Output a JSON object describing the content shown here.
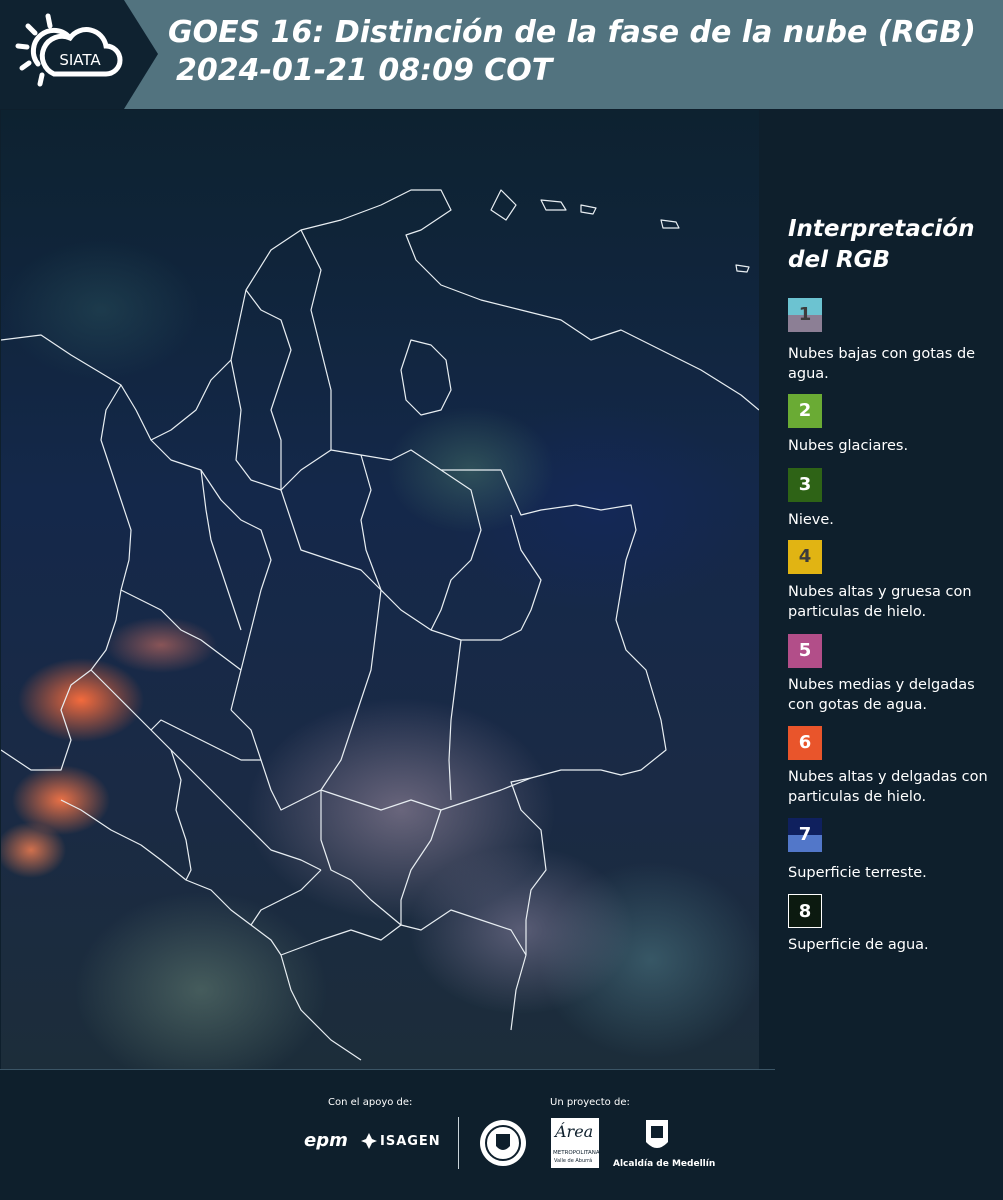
{
  "header": {
    "logo_text": "SIATA",
    "title": "GOES 16: Distinción de la fase de la nube (RGB)",
    "subtitle": "2024-01-21 08:09 COT"
  },
  "legend": {
    "title": "Interpretación del RGB",
    "items": [
      {
        "number": "1",
        "label": "Nubes bajas con gotas de agua.",
        "color_top": "#6cc3d1",
        "color_bottom": "#8c7f95"
      },
      {
        "number": "2",
        "label": "Nubes glaciares.",
        "color_top": "#6aab34",
        "color_bottom": "#6aab34"
      },
      {
        "number": "3",
        "label": "Nieve.",
        "color_top": "#2e6316",
        "color_bottom": "#2e6316"
      },
      {
        "number": "4",
        "label": "Nubes altas y gruesa con particulas de hielo.",
        "color_top": "#e1b413",
        "color_bottom": "#e1b413"
      },
      {
        "number": "5",
        "label": "Nubes medias y delgadas con gotas de agua.",
        "color_top": "#b24e89",
        "color_bottom": "#b24e89"
      },
      {
        "number": "6",
        "label": "Nubes altas y delgadas con particulas de hielo.",
        "color_top": "#e9552b",
        "color_bottom": "#e9552b"
      },
      {
        "number": "7",
        "label": "Superficie terreste.",
        "color_top": "#0f205e",
        "color_bottom": "#5277c9"
      },
      {
        "number": "8",
        "label": "Superficie de agua.",
        "color_top": "#0c1a10",
        "color_bottom": "#0c1a10"
      }
    ]
  },
  "footer": {
    "support_label": "Con el apoyo de:",
    "project_label": "Un proyecto de:",
    "sponsors": [
      "epm",
      "ISAGEN"
    ],
    "area_text": "Área",
    "area_subtext": "METROPOLITANA",
    "area_subtext2": "Valle de Aburrá",
    "alcaldia": "Alcaldía de Medellín"
  }
}
